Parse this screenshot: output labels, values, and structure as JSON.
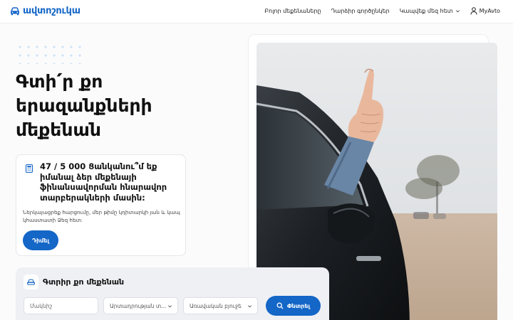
{
  "brand": {
    "name": "ավտոշուկա",
    "color": "#1466c7"
  },
  "nav": {
    "items": [
      {
        "label": "Բոլոր մեքենաները"
      },
      {
        "label": "Դարձիր գործընկեր"
      },
      {
        "label": "Կապվեք մեզ հետ",
        "has_dropdown": true
      }
    ],
    "account_label": "MyAvto"
  },
  "hero": {
    "title": "Գտի՛ր քո երազանքների մեքենան"
  },
  "info_card": {
    "title": "47 / 5 000 Ցանկանու՞մ եք իմանալ ձեր մեքենայի ֆինանսավորման հնարավոր տարբերակների մասին:",
    "description": "Ներկայացրեք հարցումը, մեր թիմը կդիտարկի յան և կապ կհաստատի Ձեզ հետ:",
    "button_label": "Դիմել"
  },
  "search": {
    "title": "Գտրիր քո մեքենան",
    "make_placeholder": "Մակնիշ",
    "manufacture_select": "Արտադրության տ...",
    "price_select": "Առավական բյուջե",
    "submit_label": "Փնտրել"
  },
  "icons": {
    "logo": "car-icon",
    "info": "calculator-icon",
    "search_section": "car-icon",
    "submit": "search-icon",
    "account": "user-icon"
  }
}
